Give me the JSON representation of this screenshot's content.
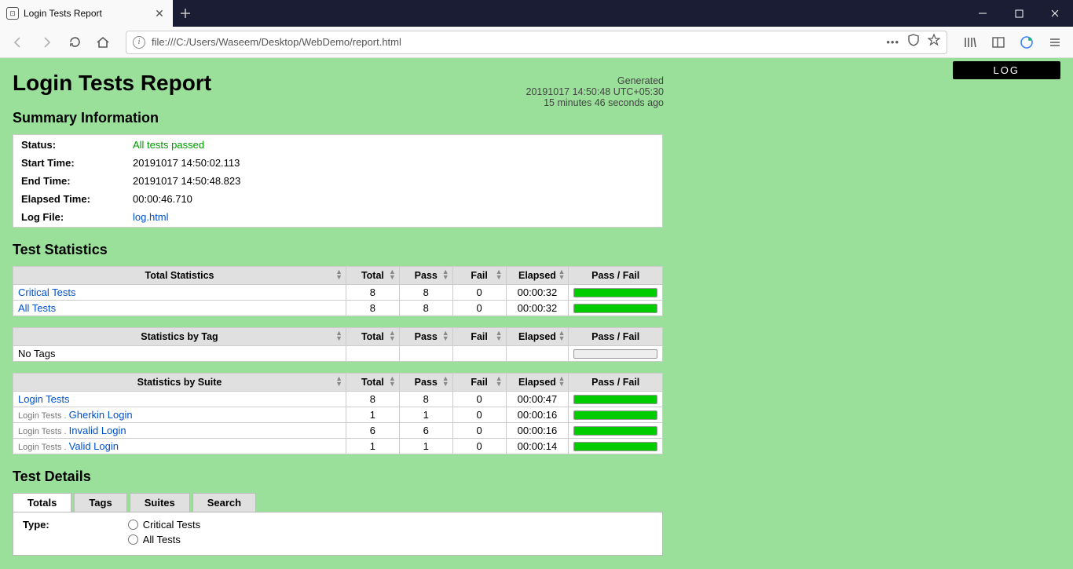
{
  "browser": {
    "tab_title": "Login Tests Report",
    "url": "file:///C:/Users/Waseem/Desktop/WebDemo/report.html"
  },
  "log_button": "LOG",
  "title": "Login Tests Report",
  "generated": {
    "label": "Generated",
    "timestamp": "20191017 14:50:48 UTC+05:30",
    "ago": "15 minutes 46 seconds ago"
  },
  "sections": {
    "summary": "Summary Information",
    "stats": "Test Statistics",
    "details": "Test Details"
  },
  "summary": {
    "status_label": "Status:",
    "status_value": "All tests passed",
    "start_label": "Start Time:",
    "start_value": "20191017 14:50:02.113",
    "end_label": "End Time:",
    "end_value": "20191017 14:50:48.823",
    "elapsed_label": "Elapsed Time:",
    "elapsed_value": "00:00:46.710",
    "logfile_label": "Log File:",
    "logfile_value": "log.html"
  },
  "stat_headers": {
    "total_stats": "Total Statistics",
    "by_tag": "Statistics by Tag",
    "by_suite": "Statistics by Suite",
    "total": "Total",
    "pass": "Pass",
    "fail": "Fail",
    "elapsed": "Elapsed",
    "passfail": "Pass / Fail"
  },
  "total_stats": [
    {
      "name": "Critical Tests",
      "total": "8",
      "pass": "8",
      "fail": "0",
      "elapsed": "00:00:32"
    },
    {
      "name": "All Tests",
      "total": "8",
      "pass": "8",
      "fail": "0",
      "elapsed": "00:00:32"
    }
  ],
  "tag_stats_empty": "No Tags",
  "suite_stats": [
    {
      "prefix": "",
      "name": "Login Tests",
      "total": "8",
      "pass": "8",
      "fail": "0",
      "elapsed": "00:00:47"
    },
    {
      "prefix": "Login Tests . ",
      "name": "Gherkin Login",
      "total": "1",
      "pass": "1",
      "fail": "0",
      "elapsed": "00:00:16"
    },
    {
      "prefix": "Login Tests . ",
      "name": "Invalid Login",
      "total": "6",
      "pass": "6",
      "fail": "0",
      "elapsed": "00:00:16"
    },
    {
      "prefix": "Login Tests . ",
      "name": "Valid Login",
      "total": "1",
      "pass": "1",
      "fail": "0",
      "elapsed": "00:00:14"
    }
  ],
  "details": {
    "tabs": [
      "Totals",
      "Tags",
      "Suites",
      "Search"
    ],
    "type_label": "Type:",
    "radios": [
      "Critical Tests",
      "All Tests"
    ]
  }
}
